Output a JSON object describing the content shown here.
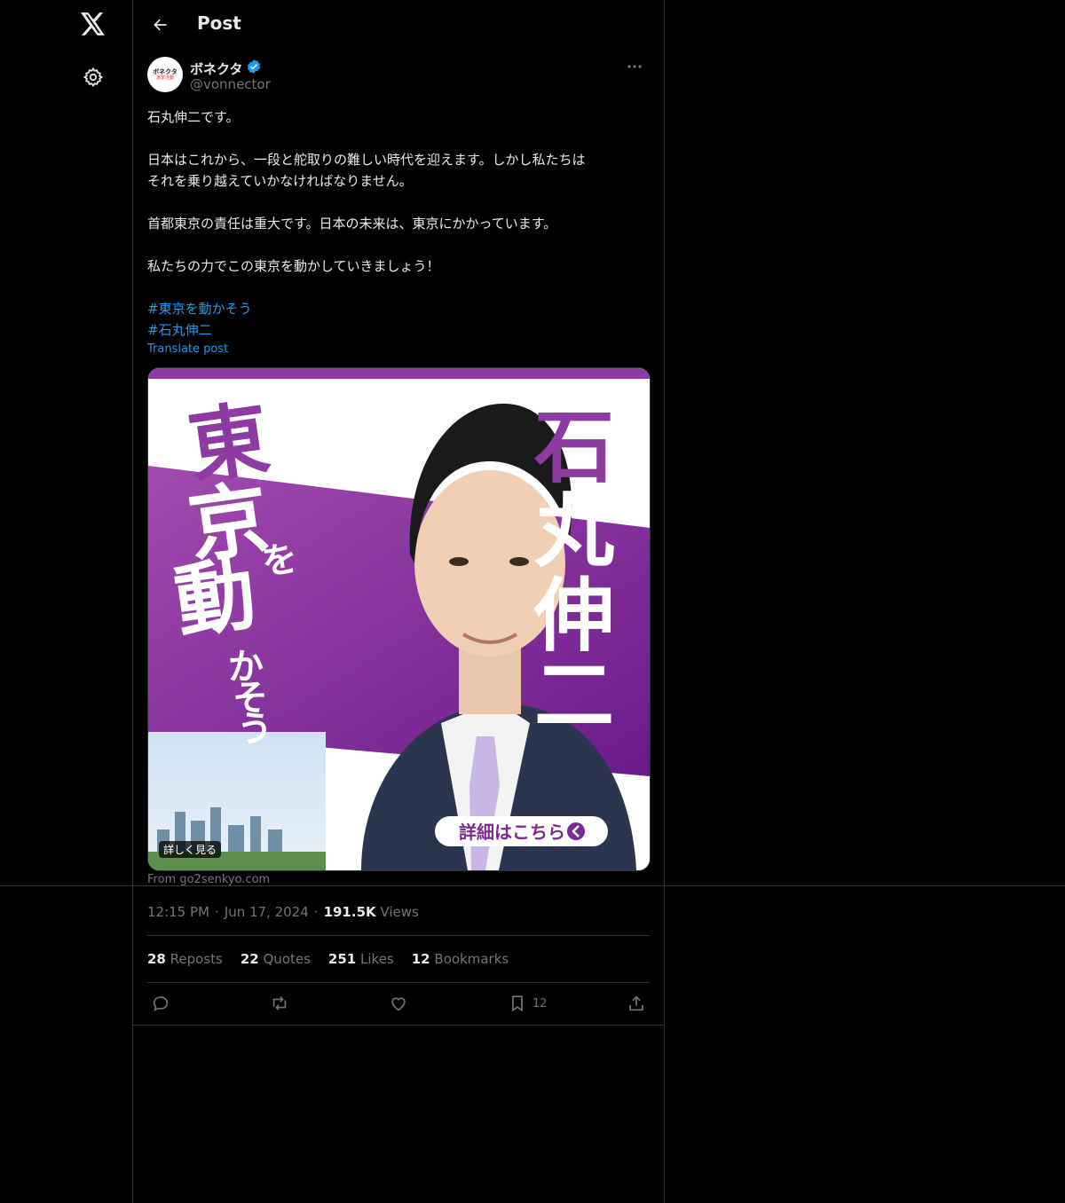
{
  "nav": {
    "logo_icon": "x-logo-icon",
    "settings_icon": "gear-icon"
  },
  "header": {
    "back_icon": "arrow-left-icon",
    "title": "Post"
  },
  "post": {
    "author": {
      "avatar_line1": "ボネクタ",
      "avatar_line2": "選挙活動",
      "name": "ボネクタ",
      "verified": true,
      "handle": "@vonnector"
    },
    "more_icon": "ellipsis-icon",
    "body": [
      "石丸伸二です。",
      "日本はこれから、一段と舵取りの難しい時代を迎えます。しかし私たちは\nそれを乗り越えていかなければなりません。",
      "首都東京の責任は重大です。日本の未来は、東京にかかっています。",
      "私たちの力でこの東京を動かしていきましょう！"
    ],
    "hashtags": [
      "#東京を動かそう",
      "#石丸伸二"
    ],
    "translate": "Translate post",
    "card": {
      "slogan_1": "東京を",
      "slogan_2": "動かそう",
      "candidate_name": "石丸伸二",
      "cta": "詳細はこちら",
      "badge": "詳しく見る",
      "accent": "#7b2a93"
    },
    "from": "From go2senkyo.com",
    "time": "12:15 PM",
    "date": "Jun 17, 2024",
    "views_count": "191.5K",
    "views_label": "Views",
    "stats": {
      "reposts_count": "28",
      "reposts_label": "Reposts",
      "quotes_count": "22",
      "quotes_label": "Quotes",
      "likes_count": "251",
      "likes_label": "Likes",
      "bookmarks_count": "12",
      "bookmarks_label": "Bookmarks"
    },
    "actions": {
      "reply_icon": "reply-icon",
      "repost_icon": "repost-icon",
      "like_icon": "heart-icon",
      "bookmark_icon": "bookmark-icon",
      "bookmark_count": "12",
      "share_icon": "share-icon"
    }
  },
  "colors": {
    "background": "#000000",
    "text": "#e7e9ea",
    "muted": "#71767b",
    "link": "#1d9bf0",
    "border": "#2f3336"
  }
}
